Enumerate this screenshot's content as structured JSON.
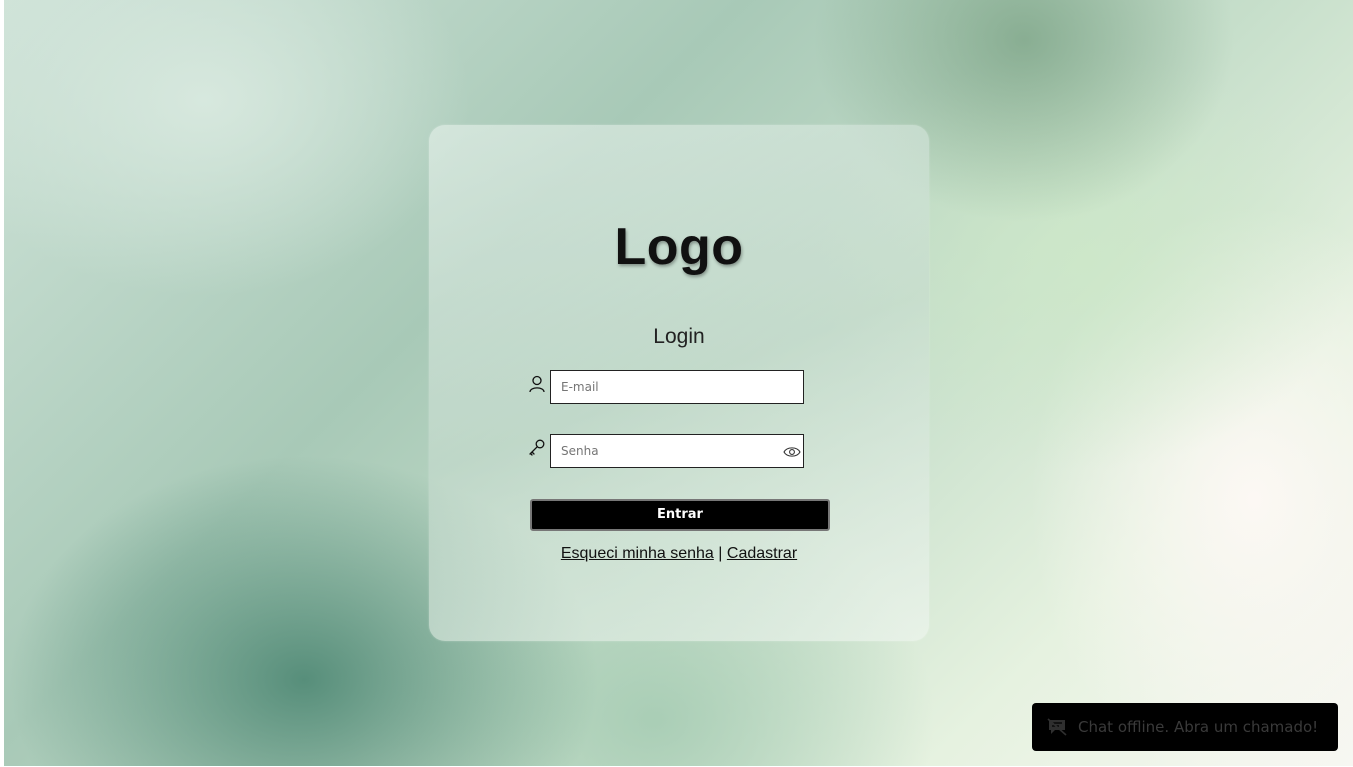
{
  "card": {
    "logo": "Logo",
    "title": "Login",
    "email": {
      "placeholder": "E-mail",
      "icon": "user-icon"
    },
    "password": {
      "placeholder": "Senha",
      "icon": "key-icon",
      "toggle_icon": "eye-icon"
    },
    "submit_label": "Entrar",
    "links": {
      "forgot": "Esqueci minha senha",
      "separator": "|",
      "register": "Cadastrar"
    }
  },
  "chat": {
    "icon": "chat-offline-icon",
    "label": "Chat offline. Abra um chamado!"
  },
  "colors": {
    "button_bg": "#000000",
    "button_text": "#ffffff",
    "chat_bg": "#000000"
  }
}
